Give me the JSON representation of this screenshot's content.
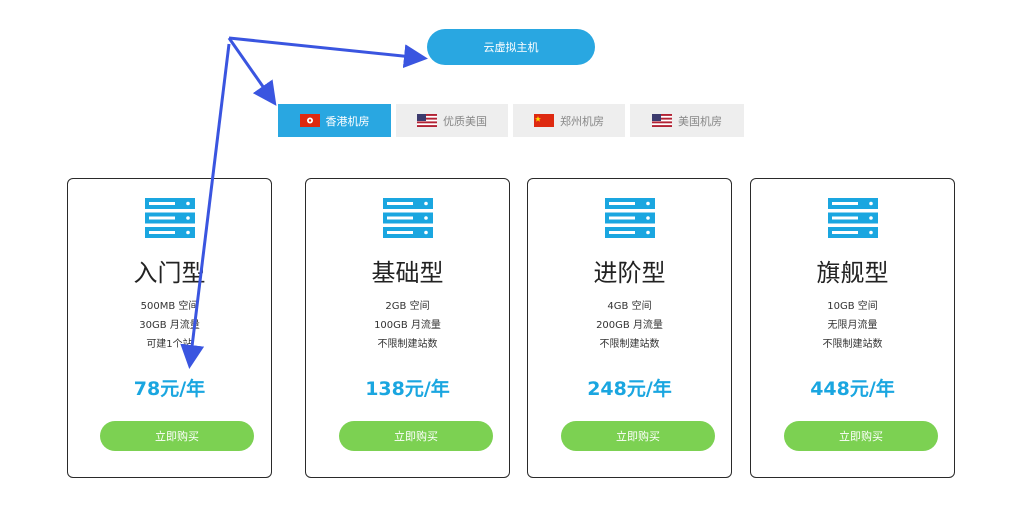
{
  "header": {
    "button_label": "云虚拟主机"
  },
  "tabs": [
    {
      "label": "香港机房",
      "flag": "hk-flag-icon",
      "active": true
    },
    {
      "label": "优质美国",
      "flag": "us-flag-icon",
      "active": false
    },
    {
      "label": "郑州机房",
      "flag": "cn-flag-icon",
      "active": false
    },
    {
      "label": "美国机房",
      "flag": "us-flag-icon",
      "active": false
    }
  ],
  "plans": [
    {
      "name": "入门型",
      "features": [
        "500MB 空间",
        "30GB 月流量",
        "可建1个站"
      ],
      "price": "78元/年",
      "buy_label": "立即购买"
    },
    {
      "name": "基础型",
      "features": [
        "2GB 空间",
        "100GB 月流量",
        "不限制建站数"
      ],
      "price": "138元/年",
      "buy_label": "立即购买"
    },
    {
      "name": "进阶型",
      "features": [
        "4GB 空间",
        "200GB 月流量",
        "不限制建站数"
      ],
      "price": "248元/年",
      "buy_label": "立即购买"
    },
    {
      "name": "旗舰型",
      "features": [
        "10GB 空间",
        "无限月流量",
        "不限制建站数"
      ],
      "price": "448元/年",
      "buy_label": "立即购买"
    }
  ],
  "colors": {
    "accent": "#29a7e1",
    "price": "#1aa6e0",
    "buy_button": "#7cd152",
    "annotation_arrow": "#3a55e0"
  },
  "icons": {
    "plan_icon": "server-icon"
  }
}
